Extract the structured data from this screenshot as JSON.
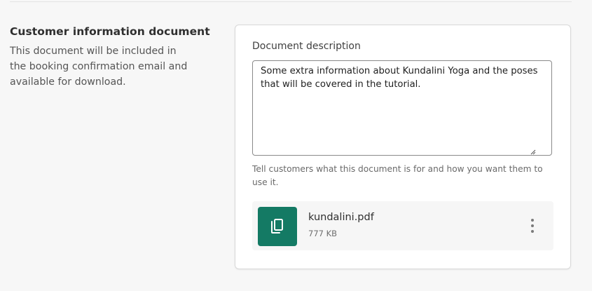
{
  "section": {
    "title": "Customer information document",
    "description": "This document will be included in the booking confirmation email and available for download."
  },
  "document_description": {
    "label": "Document description",
    "value": "Some extra information about Kundalini Yoga and the poses that will be covered in the tutorial.",
    "help_text": "Tell customers what this document is for and how you want them to use it."
  },
  "file": {
    "name": "kundalini.pdf",
    "size": "777 KB",
    "icon": "document-copy-icon",
    "icon_bg_color": "#147a64",
    "menu_icon": "more-vertical-icon"
  }
}
